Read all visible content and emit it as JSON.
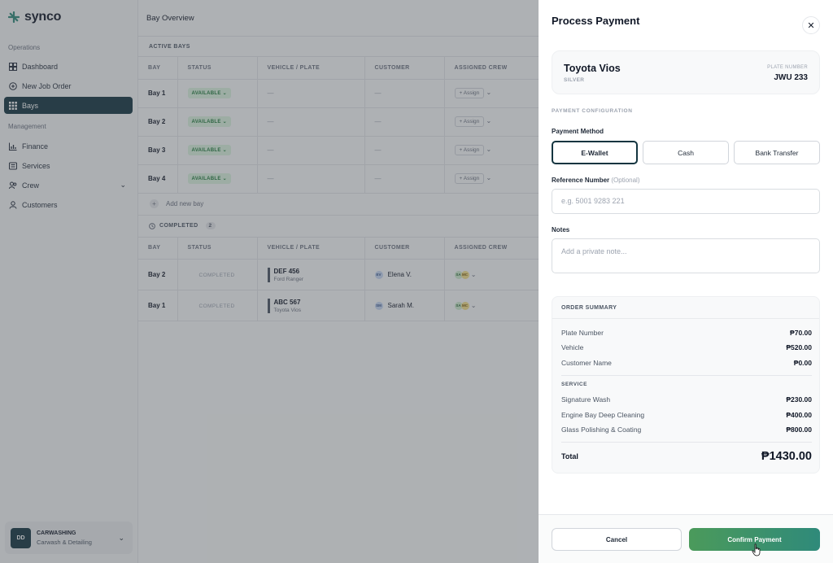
{
  "app": {
    "name": "synco",
    "brand_color": "#143540",
    "accent_color": "#2f8a7a"
  },
  "sidebar": {
    "section_operations": "Operations",
    "section_management": "Management",
    "items": [
      {
        "label": "Dashboard",
        "icon": "dashboard-icon"
      },
      {
        "label": "New Job Order",
        "icon": "plus-circle-icon"
      },
      {
        "label": "Bays",
        "icon": "grid-icon",
        "active": true
      },
      {
        "label": "Finance",
        "icon": "bar-chart-icon"
      },
      {
        "label": "Services",
        "icon": "list-icon"
      },
      {
        "label": "Crew",
        "icon": "users-icon"
      },
      {
        "label": "Customers",
        "icon": "user-icon"
      }
    ],
    "account": {
      "initials": "DD",
      "name": "CARWASHING",
      "subtitle": "Carwash & Detailing"
    }
  },
  "main": {
    "title": "Bay Overview",
    "active_label": "ACTIVE BAYS",
    "columns": [
      "BAY",
      "STATUS",
      "VEHICLE / PLATE",
      "CUSTOMER",
      "ASSIGNED CREW"
    ],
    "active_rows": [
      {
        "bay": "Bay 1",
        "status": "AVAILABLE",
        "vehicle": "—",
        "customer": "—",
        "crew": "+ Assign"
      },
      {
        "bay": "Bay 2",
        "status": "AVAILABLE",
        "vehicle": "—",
        "customer": "—",
        "crew": "+ Assign"
      },
      {
        "bay": "Bay 3",
        "status": "AVAILABLE",
        "vehicle": "—",
        "customer": "—",
        "crew": "+ Assign"
      },
      {
        "bay": "Bay 4",
        "status": "AVAILABLE",
        "vehicle": "—",
        "customer": "—",
        "crew": "+ Assign"
      }
    ],
    "add_bay": "Add new bay",
    "completed_label": "COMPLETED",
    "completed_count": "2",
    "completed_rows": [
      {
        "bay": "Bay 2",
        "status": "COMPLETED",
        "plate": "DEF 456",
        "model": "Ford Ranger",
        "customer_initials": "EV",
        "customer": "Elena V.",
        "crew": [
          "SA",
          "MC"
        ]
      },
      {
        "bay": "Bay 1",
        "status": "COMPLETED",
        "plate": "ABC 567",
        "model": "Toyota Vios",
        "customer_initials": "SM",
        "customer": "Sarah M.",
        "crew": [
          "SA",
          "MC"
        ]
      }
    ]
  },
  "modal": {
    "title": "Process Payment",
    "vehicle": {
      "name": "Toyota Vios",
      "color": "SILVER",
      "plate_label": "PLATE NUMBER",
      "plate": "JWU 233"
    },
    "config_label": "PAYMENT CONFIGURATION",
    "method_label": "Payment Method",
    "methods": [
      "E-Wallet",
      "Cash",
      "Bank Transfer"
    ],
    "selected_method": "E-Wallet",
    "reference_label": "Reference Number",
    "reference_optional": "(Optional)",
    "reference_placeholder": "e.g. 5001 9283 221",
    "notes_label": "Notes",
    "notes_placeholder": "Add a private note...",
    "summary": {
      "title": "ORDER SUMMARY",
      "items": [
        {
          "label": "Plate Number",
          "value": "₱70.00"
        },
        {
          "label": "Vehicle",
          "value": "₱520.00"
        },
        {
          "label": "Customer Name",
          "value": "₱0.00"
        }
      ],
      "service_label": "SERVICE",
      "services": [
        {
          "label": "Signature Wash",
          "value": "₱230.00"
        },
        {
          "label": "Engine Bay Deep Cleaning",
          "value": "₱400.00"
        },
        {
          "label": "Glass Polishing & Coating",
          "value": "₱800.00"
        }
      ],
      "total_label": "Total",
      "total_value": "₱1430.00"
    },
    "cancel_label": "Cancel",
    "confirm_label": "Confirm Payment"
  }
}
